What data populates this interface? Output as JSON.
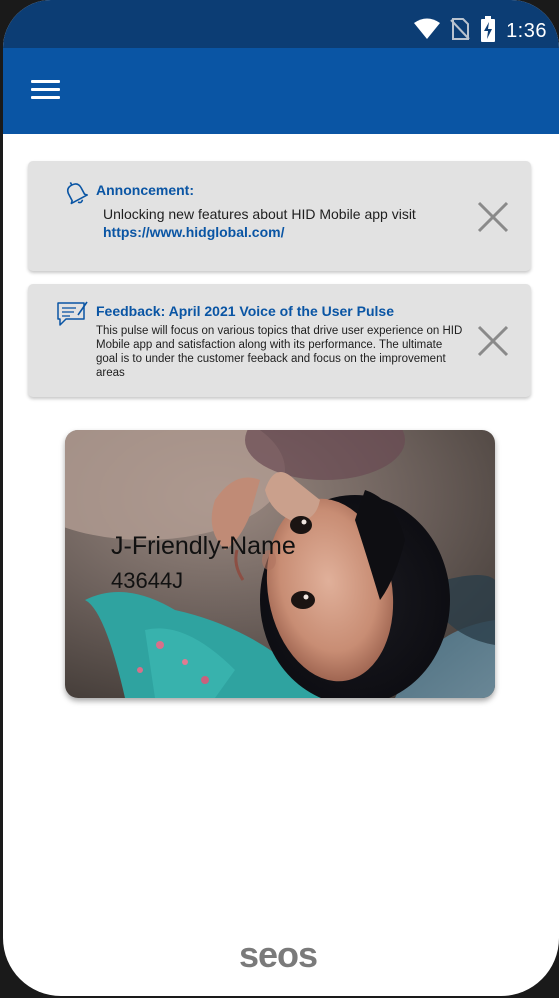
{
  "status_bar": {
    "time": "1:36",
    "icons": [
      "wifi-icon",
      "no-sim-icon",
      "battery-charging-icon"
    ],
    "background_color": "#0c3d74"
  },
  "app_bar": {
    "menu_icon": "hamburger-menu-icon",
    "background_color": "#0a55a4"
  },
  "announcement": {
    "icon": "bell-icon",
    "title": "Annoncement:",
    "body_text": "Unlocking new features about HID Mobile app visit",
    "link_text": "https://www.hidglobal.com/",
    "close_icon": "close-icon"
  },
  "feedback": {
    "icon": "feedback-note-icon",
    "title": "Feedback: April 2021 Voice of the User Pulse",
    "body_text": "This pulse will focus on various topics that drive user experience on HID Mobile app and satisfaction along with its performance.  The ultimate goal is to under the customer feeback and focus on the improvement areas",
    "close_icon": "close-icon"
  },
  "credential_card": {
    "name": "J-Friendly-Name",
    "id": "43644J",
    "photo": "child-portrait-photo"
  },
  "footer": {
    "logo_text": "seos"
  },
  "colors": {
    "accent": "#0a55a4",
    "card_background": "#e2e2e2",
    "close_icon": "#8a8a8a",
    "logo": "#7a7a7a"
  }
}
